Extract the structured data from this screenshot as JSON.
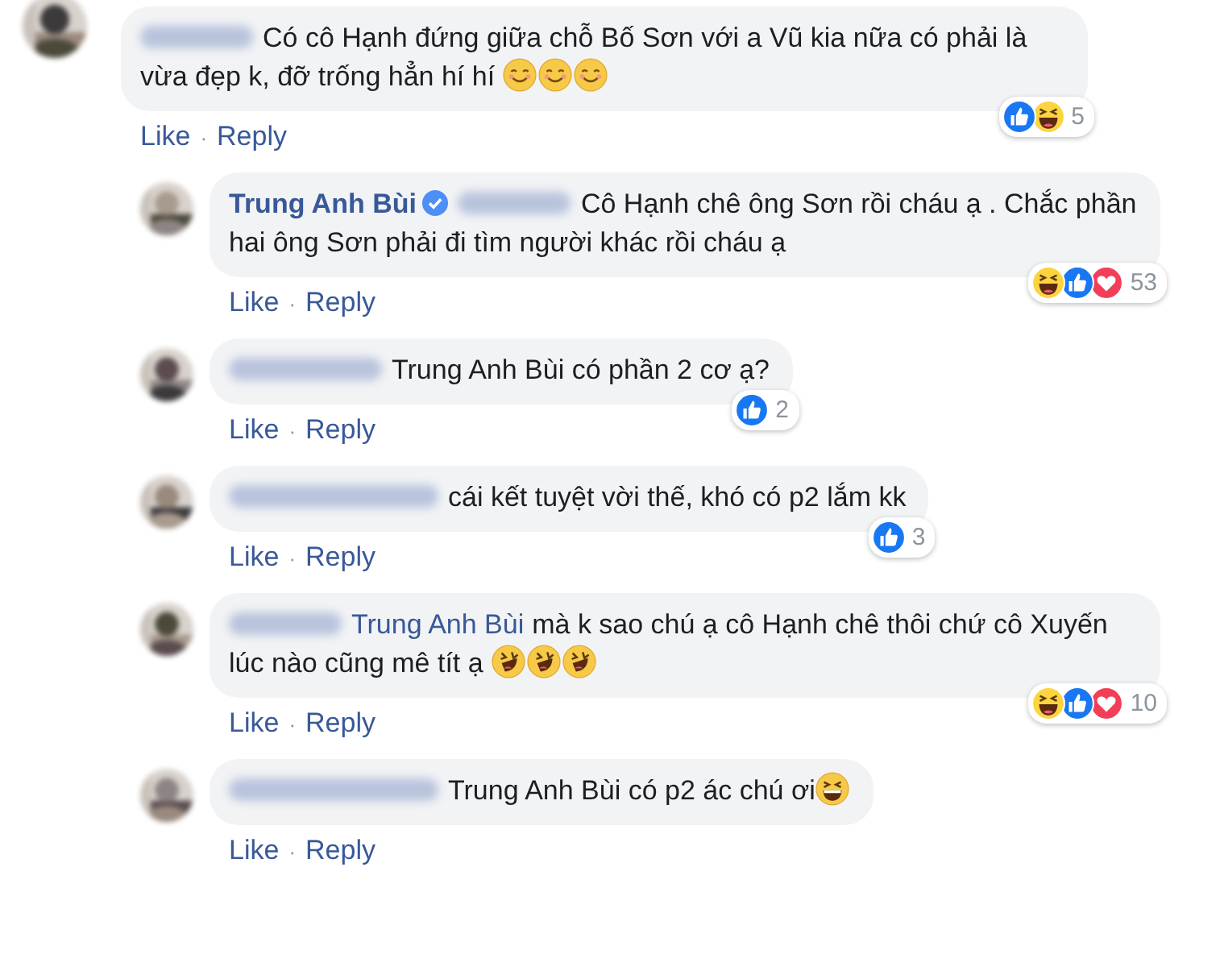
{
  "separator": "·",
  "comments": [
    {
      "reply": false,
      "author": {
        "kind": "blurred_short"
      },
      "segments": [
        {
          "kind": "text",
          "text": "Có cô Hạnh đứng giữa chỗ Bố Sơn với a Vũ kia nữa có phải là vừa đẹp k, đỡ trống hẳn hí hí "
        },
        {
          "kind": "smile_emoji"
        },
        {
          "kind": "smile_emoji"
        },
        {
          "kind": "smile_emoji"
        }
      ],
      "reactions": [
        {
          "kind": "like"
        },
        {
          "kind": "haha"
        }
      ],
      "reaction_count": "5",
      "actions": [
        "Like",
        "Reply"
      ]
    },
    {
      "reply": true,
      "author": {
        "kind": "name",
        "name": "Trung Anh Bùi",
        "verified": true
      },
      "mention": {
        "kind": "blurred_short"
      },
      "segments": [
        {
          "kind": "text",
          "text": "Cô Hạnh chê ông Sơn rồi cháu ạ . Chắc phần hai ông Sơn phải đi tìm người khác rồi cháu ạ"
        }
      ],
      "reactions": [
        {
          "kind": "haha"
        },
        {
          "kind": "like"
        },
        {
          "kind": "love"
        }
      ],
      "reaction_count": "53",
      "actions": [
        "Like",
        "Reply"
      ]
    },
    {
      "reply": true,
      "author": {
        "kind": "blurred_medium"
      },
      "segments": [
        {
          "kind": "text",
          "text": "Trung Anh Bùi có phần 2 cơ ạ?"
        }
      ],
      "reactions": [
        {
          "kind": "like"
        }
      ],
      "reaction_count": "2",
      "actions": [
        "Like",
        "Reply"
      ]
    },
    {
      "reply": true,
      "author": {
        "kind": "blurred_long"
      },
      "segments": [
        {
          "kind": "text",
          "text": "cái kết tuyệt vời thế, khó có p2 lắm kk"
        }
      ],
      "reactions": [
        {
          "kind": "like"
        }
      ],
      "reaction_count": "3",
      "actions": [
        "Like",
        "Reply"
      ]
    },
    {
      "reply": true,
      "author": {
        "kind": "blurred_short"
      },
      "mention": {
        "kind": "name",
        "name": "Trung Anh Bùi"
      },
      "segments": [
        {
          "kind": "text",
          "text": "mà k sao chú ạ cô Hạnh chê thôi chứ cô Xuyến lúc nào cũng mê tít ạ "
        },
        {
          "kind": "rofl_emoji"
        },
        {
          "kind": "rofl_emoji"
        },
        {
          "kind": "rofl_emoji"
        }
      ],
      "reactions": [
        {
          "kind": "haha"
        },
        {
          "kind": "like"
        },
        {
          "kind": "love"
        }
      ],
      "reaction_count": "10",
      "actions": [
        "Like",
        "Reply"
      ]
    },
    {
      "reply": true,
      "author": {
        "kind": "blurred_long"
      },
      "segments": [
        {
          "kind": "text",
          "text": "Trung Anh Bùi có p2 ác chú ơi"
        },
        {
          "kind": "laugh_emoji"
        }
      ],
      "actions": [
        "Like",
        "Reply"
      ]
    }
  ]
}
